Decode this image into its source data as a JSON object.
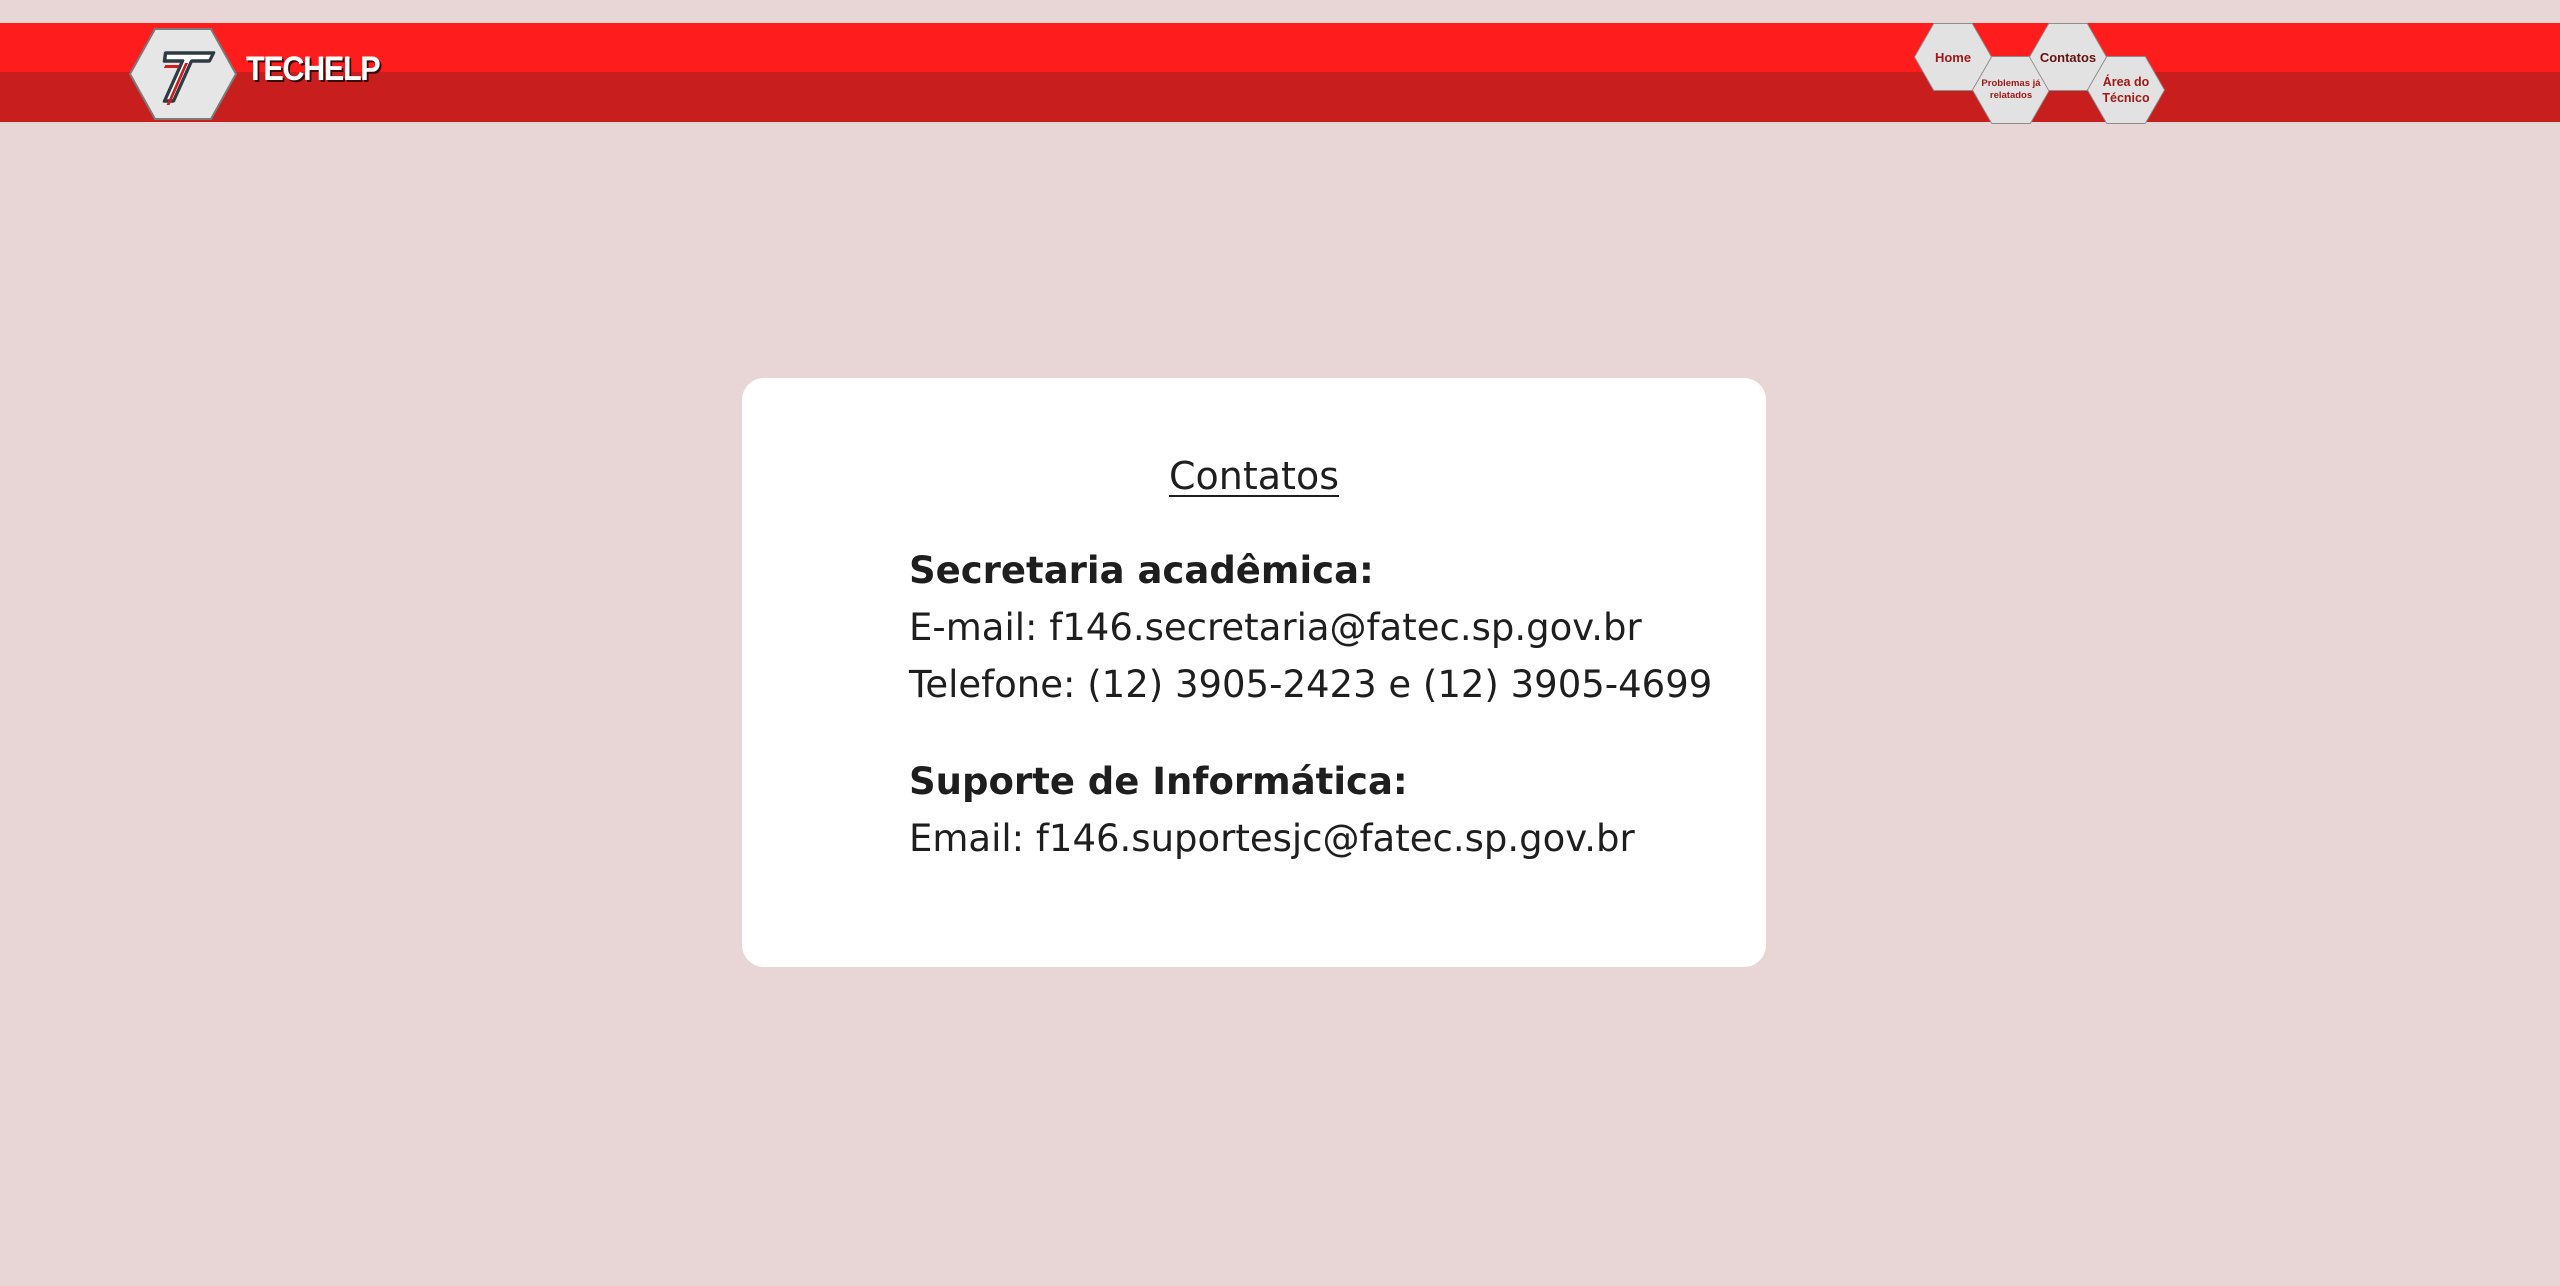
{
  "header": {
    "brand": "TECHELP",
    "nav": {
      "home": "Home",
      "problemas": "Problemas já relatados",
      "contatos": "Contatos",
      "area_tecnico": "Área do Técnico"
    }
  },
  "card": {
    "title": "Contatos",
    "sections": [
      {
        "heading": "Secretaria acadêmica:",
        "lines": [
          "E-mail: f146.secretaria@fatec.sp.gov.br",
          "Telefone: (12) 3905-2423 e (12) 3905-4699"
        ]
      },
      {
        "heading": "Suporte de Informática:",
        "lines": [
          "Email: f146.suportesjc@fatec.sp.gov.br"
        ]
      }
    ]
  },
  "colors": {
    "page_background": "#e8d6d6",
    "header_top": "#ff1c1c",
    "header_bottom": "#c81e1e",
    "nav_text": "#a01818",
    "card_background": "#ffffff"
  }
}
